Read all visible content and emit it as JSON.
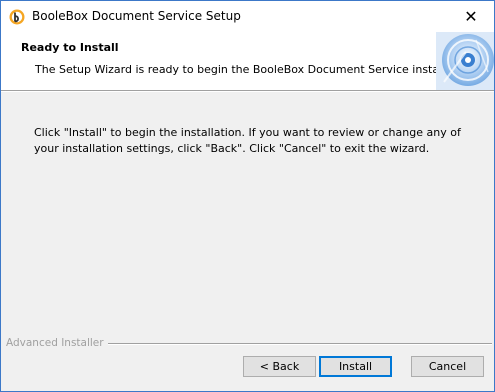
{
  "window": {
    "title": "BooleBox Document Service Setup",
    "close_glyph": "✕",
    "icon": "booleBox-app-icon"
  },
  "header": {
    "title": "Ready to Install",
    "subtitle": "The Setup Wizard is ready to begin the BooleBox Document Service installation",
    "graphic": "installer-disc-graphic"
  },
  "body": {
    "text": "Click \"Install\" to begin the installation.  If you want to review or change any of your installation settings, click \"Back\".  Click \"Cancel\" to exit the wizard."
  },
  "footer": {
    "brand": "Advanced Installer"
  },
  "buttons": {
    "back": "< Back",
    "install": "Install",
    "cancel": "Cancel"
  },
  "colors": {
    "accent": "#0078d7",
    "window_border": "#3c78c8",
    "dialog_background": "#f0f0f0",
    "header_background": "#ffffff"
  }
}
